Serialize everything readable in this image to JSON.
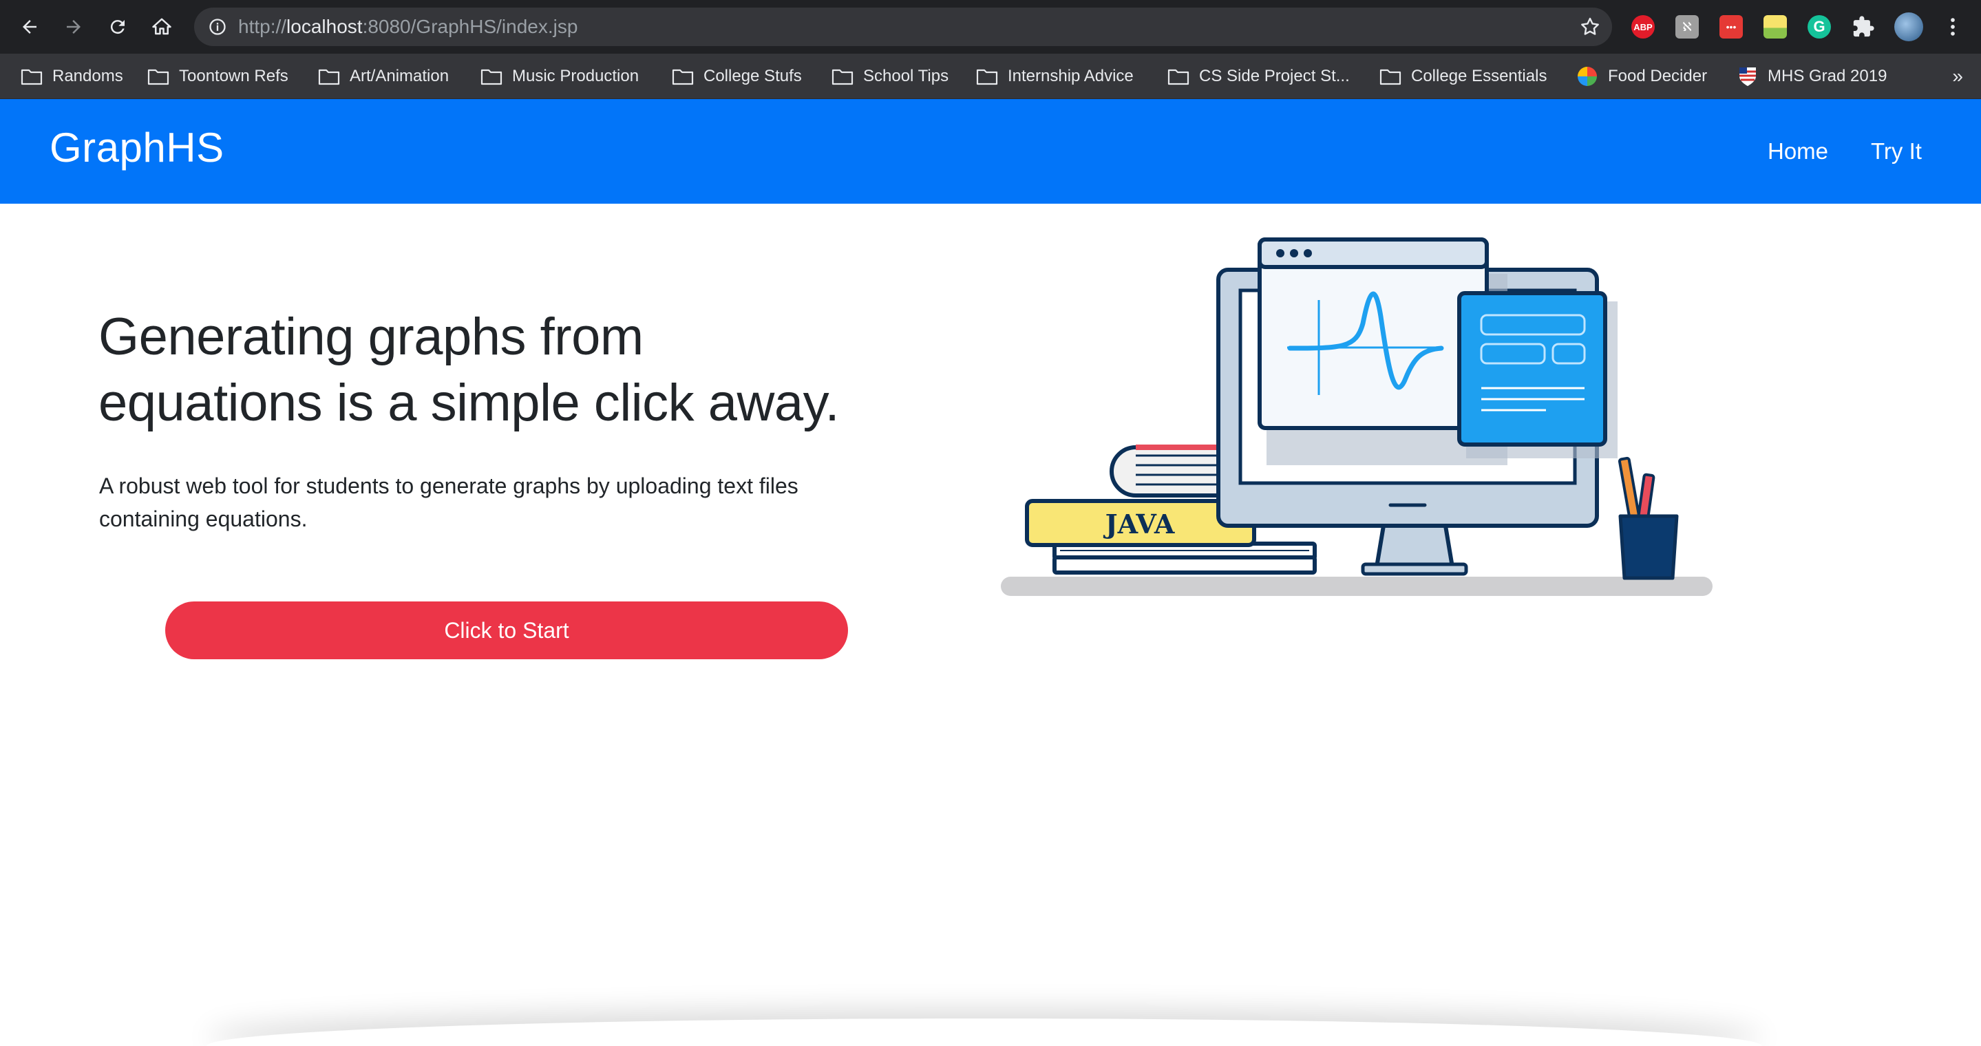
{
  "browser": {
    "url_scheme": "http://",
    "url_host": "localhost",
    "url_rest": ":8080/GraphHS/index.jsp",
    "extensions": [
      {
        "name": "adblock-icon",
        "label": "ABP",
        "color": "#e21c2a"
      },
      {
        "name": "extension-2-icon",
        "label": "",
        "color": "#9e9e9e"
      },
      {
        "name": "extension-3-icon",
        "label": "•••",
        "color": "#e53935"
      },
      {
        "name": "extension-4-icon",
        "label": "",
        "color": "#8bc34a"
      },
      {
        "name": "grammarly-icon",
        "label": "G",
        "color": "#15c39a"
      }
    ]
  },
  "bookmarks": [
    {
      "label": "Randoms",
      "icon": "folder-icon"
    },
    {
      "label": "Toontown Refs",
      "icon": "folder-icon"
    },
    {
      "label": "Art/Animation",
      "icon": "folder-icon"
    },
    {
      "label": "Music Production",
      "icon": "folder-icon"
    },
    {
      "label": "College Stufs",
      "icon": "folder-icon"
    },
    {
      "label": "School Tips",
      "icon": "folder-icon"
    },
    {
      "label": "Internship Advice",
      "icon": "folder-icon"
    },
    {
      "label": "CS Side Project St...",
      "icon": "folder-icon"
    },
    {
      "label": "College Essentials",
      "icon": "folder-icon"
    },
    {
      "label": "Food Decider",
      "icon": "color-wheel-icon"
    },
    {
      "label": "MHS Grad 2019",
      "icon": "shield-flag-icon"
    }
  ],
  "bookmarks_more": "»",
  "site": {
    "brand": "GraphHS",
    "nav": [
      "Home",
      "Try It"
    ],
    "accent": "#0275f9"
  },
  "hero": {
    "title_line1": "Generating graphs from",
    "title_line2": "equations is a simple click away.",
    "text_line1": "A robust web tool for students to generate graphs by uploading text files",
    "text_line2": "containing equations.",
    "cta": "Click to Start",
    "cta_color": "#ec3548"
  },
  "illustration": {
    "book_label": "JAVA"
  }
}
